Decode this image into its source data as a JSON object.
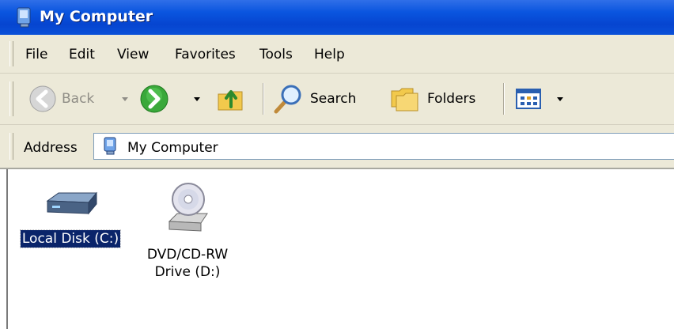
{
  "window": {
    "title": "My Computer"
  },
  "menubar": {
    "items": [
      "File",
      "Edit",
      "View",
      "Favorites",
      "Tools",
      "Help"
    ]
  },
  "toolbar": {
    "back_label": "Back",
    "search_label": "Search",
    "folders_label": "Folders"
  },
  "addressbar": {
    "label": "Address",
    "value": "My Computer"
  },
  "content": {
    "items": [
      {
        "label": "Local Disk (C:)",
        "selected": true
      },
      {
        "label_line1": "DVD/CD-RW",
        "label_line2": "Drive (D:)",
        "selected": false
      }
    ]
  },
  "colors": {
    "titlebar": "#0a55df",
    "chrome": "#ece9d8",
    "selection": "#0a246a"
  }
}
